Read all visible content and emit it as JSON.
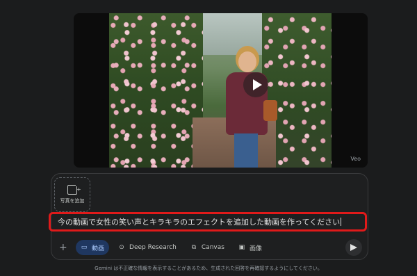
{
  "video": {
    "watermark": "Veo",
    "play_icon": "play-icon"
  },
  "composer": {
    "add_photo_label": "写真を追加",
    "add_photo_icon": "add-photo-icon",
    "prompt_text": "今の動画で女性の笑い声とキラキラのエフェクトを追加した動画を作ってください",
    "toolbar": {
      "plus_icon": "+",
      "tools": [
        {
          "label": "動画",
          "icon": "video-icon",
          "active": true
        },
        {
          "label": "Deep Research",
          "icon": "deep-research-icon",
          "active": false
        },
        {
          "label": "Canvas",
          "icon": "canvas-icon",
          "active": false
        },
        {
          "label": "画像",
          "icon": "image-icon",
          "active": false
        }
      ],
      "send_icon": "send-icon"
    },
    "highlight_color": "#e01a1a",
    "active_chip_color": "#1f3760"
  },
  "footer": {
    "disclaimer": "Gemini は不正確な情報を表示することがあるため、生成された回答を再確認するようにしてください。"
  }
}
